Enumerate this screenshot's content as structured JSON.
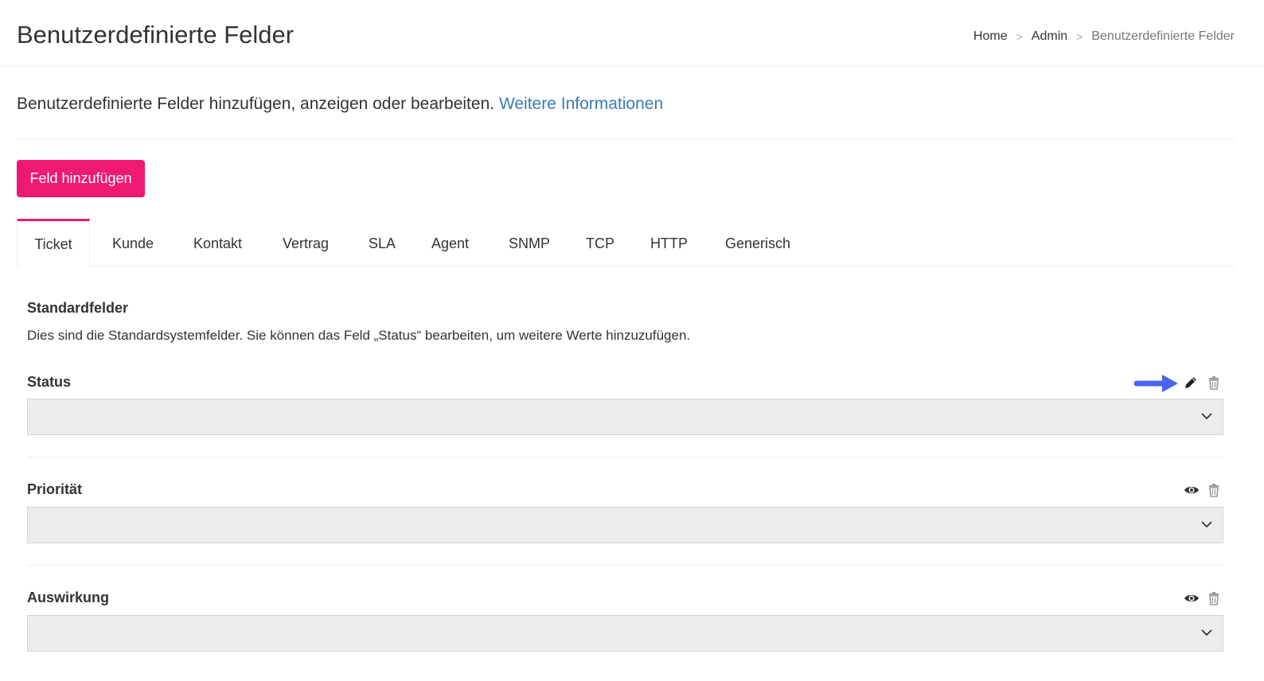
{
  "header": {
    "title": "Benutzerdefinierte Felder",
    "breadcrumb": [
      {
        "label": "Home"
      },
      {
        "label": "Admin"
      },
      {
        "label": "Benutzerdefinierte Felder"
      }
    ],
    "breadcrumb_separator": ">"
  },
  "intro": {
    "text": "Benutzerdefinierte Felder hinzufügen, anzeigen oder bearbeiten.",
    "link_label": "Weitere Informationen"
  },
  "toolbar": {
    "add_label": "Feld hinzufügen"
  },
  "tabs": [
    {
      "label": "Ticket",
      "active": true
    },
    {
      "label": "Kunde"
    },
    {
      "label": "Kontakt"
    },
    {
      "label": "Vertrag"
    },
    {
      "label": "SLA"
    },
    {
      "label": "Agent"
    },
    {
      "label": "SNMP"
    },
    {
      "label": "TCP"
    },
    {
      "label": "HTTP"
    },
    {
      "label": "Generisch"
    }
  ],
  "section": {
    "title": "Standardfelder",
    "description": "Dies sind die Standardsystemfelder. Sie können das Feld „Status“ bearbeiten, um weitere Werte hinzuzufügen."
  },
  "fields": [
    {
      "label": "Status",
      "actions": [
        "pencil-icon",
        "trash-icon"
      ],
      "value": ""
    },
    {
      "label": "Priorität",
      "actions": [
        "eye-icon",
        "trash-icon"
      ],
      "value": ""
    },
    {
      "label": "Auswirkung",
      "actions": [
        "eye-icon",
        "trash-icon"
      ],
      "value": ""
    }
  ],
  "colors": {
    "accent": "#ee1a71",
    "link": "#3a7bb8",
    "annotation_arrow": "#4a63f0"
  }
}
